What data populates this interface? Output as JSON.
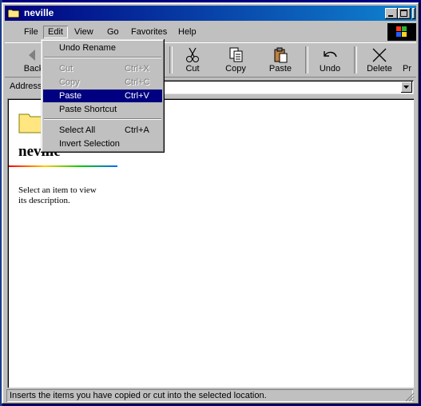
{
  "window": {
    "title": "neville"
  },
  "menubar": [
    "File",
    "Edit",
    "View",
    "Go",
    "Favorites",
    "Help"
  ],
  "toolbar": {
    "back": "Back",
    "cut": "Cut",
    "copy": "Copy",
    "paste": "Paste",
    "undo": "Undo",
    "delete": "Delete",
    "properties_partial": "Pr"
  },
  "address": {
    "label": "Address",
    "value": ""
  },
  "content": {
    "folder_name": "neville",
    "description_line1": "Select an item to view",
    "description_line2": "its description."
  },
  "status": {
    "text": "Inserts the items you have copied or cut into the selected location."
  },
  "edit_menu": {
    "items": [
      {
        "label": "Undo Rename",
        "shortcut": "",
        "state": "enabled"
      },
      {
        "label": "Cut",
        "shortcut": "Ctrl+X",
        "state": "disabled"
      },
      {
        "label": "Copy",
        "shortcut": "Ctrl+C",
        "state": "disabled"
      },
      {
        "label": "Paste",
        "shortcut": "Ctrl+V",
        "state": "selected"
      },
      {
        "label": "Paste Shortcut",
        "shortcut": "",
        "state": "enabled"
      },
      {
        "label": "Select All",
        "shortcut": "Ctrl+A",
        "state": "enabled"
      },
      {
        "label": "Invert Selection",
        "shortcut": "",
        "state": "enabled"
      }
    ]
  },
  "colors": {
    "titlebar_start": "#000080",
    "titlebar_end": "#1084d0",
    "menu_highlight": "#000080",
    "face": "#c0c0c0"
  }
}
